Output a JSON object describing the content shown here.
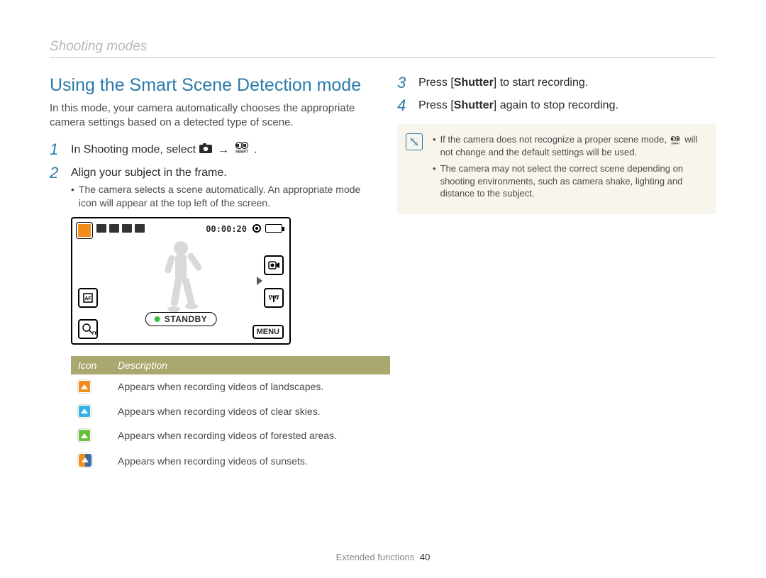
{
  "header": "Shooting modes",
  "title": "Using the Smart Scene Detection mode",
  "intro": "In this mode, your camera automatically chooses the appropriate camera settings based on a detected type of scene.",
  "steps": {
    "s1": {
      "num": "1",
      "pre": "In Shooting mode, select ",
      "post": " ."
    },
    "s2": {
      "num": "2",
      "text": "Align your subject in the frame.",
      "note": "The camera selects a scene automatically. An appropriate mode icon will appear at the top left of the screen."
    },
    "s3": {
      "num": "3",
      "pre": "Press [",
      "bold": "Shutter",
      "post": "] to start recording."
    },
    "s4": {
      "num": "4",
      "pre": "Press [",
      "bold": "Shutter",
      "post": "] again to stop recording."
    }
  },
  "shot": {
    "time": "00:00:20",
    "standby": "STANDBY",
    "menu": "MENU"
  },
  "legend": {
    "headers": {
      "icon": "Icon",
      "desc": "Description"
    },
    "rows": [
      {
        "color": "#f28c1a",
        "desc": "Appears when recording videos of landscapes."
      },
      {
        "color": "#35b3e6",
        "desc": "Appears when recording videos of clear skies."
      },
      {
        "color": "#66c23a",
        "desc": "Appears when recording videos of forested areas."
      },
      {
        "color": "#f28c1a",
        "color2": "#3a6aa0",
        "desc": "Appears when recording videos of sunsets."
      }
    ]
  },
  "info": {
    "n1a": "If the camera does not recognize a proper scene mode, ",
    "n1b": " will not change and the default settings will be used.",
    "n2": "The camera may not select the correct scene depending on shooting environments, such as camera shake, lighting and distance to the subject."
  },
  "footer": {
    "section": "Extended functions",
    "page": "40"
  }
}
